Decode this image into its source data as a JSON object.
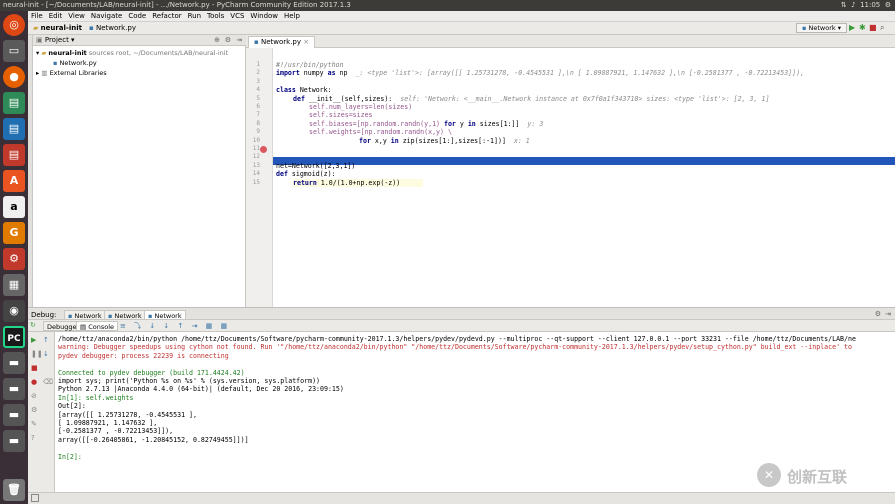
{
  "window": {
    "title": "neural-init - [~/Documents/LAB/neural-init] - .../Network.py - PyCharm Community Edition 2017.1.3",
    "clock": "11:05"
  },
  "menu": [
    "File",
    "Edit",
    "View",
    "Navigate",
    "Code",
    "Refactor",
    "Run",
    "Tools",
    "VCS",
    "Window",
    "Help"
  ],
  "nav": {
    "crumb1": "neural-init",
    "crumb2": "Network.py",
    "run_config": "Network"
  },
  "project": {
    "header": "Project",
    "root": "neural-init",
    "root_note": "sources root, ~/Documents/LAB/neural-init",
    "file": "Network.py",
    "ext": "External Libraries"
  },
  "editor": {
    "tab": "Network.py",
    "line_numbers": [
      "1",
      "2",
      "3",
      "4",
      "5",
      "6",
      "7",
      "8",
      "9",
      "10",
      "11",
      "12",
      "13",
      "14",
      "15"
    ]
  },
  "code": {
    "l1": "#!/usr/bin/python",
    "l2a": "import",
    "l2b": " numpy ",
    "l2c": "as",
    "l2d": " np",
    "l2h": "_: <type 'list'>: [array([[ 1.25731278, -0.4545531 ],\\n       [ 1.09887921,  1.147632  ],\\n       [-0.2581377 , -0.72213453]]),",
    "l4a": "class",
    "l4b": " Network:",
    "l5a": "def",
    "l5b": " __init__(self,sizes):",
    "l5h": "self: 'Network: <__main__.Network instance at 0x7f0a1f343710>  sizes: <type 'list'>: [2, 3, 1]",
    "l6": "self.num_layers=len(sizes)",
    "l7": "self.sizes=sizes",
    "l8a": "self.biases=[np.random.randn(y,1) ",
    "l8b": "for",
    "l8c": " y ",
    "l8d": "in",
    "l8e": " sizes[1:]]",
    "l8h": "y: 3",
    "l9": "self.weights=[np.random.randn(x,y) \\",
    "l10a": "for",
    "l10b": " x,y ",
    "l10c": "in",
    "l10d": " zip(sizes[1:],sizes[:-1])]",
    "l10h": "x: 1",
    "l11": "self.null=[]",
    "l13": "net=Network([2,3,1])",
    "l14a": "def",
    "l14b": " sigmoid(z):",
    "l15a": "return",
    "l15b": " 1.0/(1.0+np.exp(-z))"
  },
  "debug": {
    "label": "Debug:",
    "tabs": [
      "Network",
      "Network",
      "Network"
    ],
    "debugger_tab": "Debugger",
    "console_tab": "Console"
  },
  "console": [
    "/home/ttz/anaconda2/bin/python /home/ttz/Documents/Software/pycharm-community-2017.1.3/helpers/pydev/pydevd.py --multiproc --qt-support --client 127.0.0.1 --port 33231 --file /home/ttz/Documents/LAB/ne",
    "warning: Debugger speedups using cython not found. Run '\"/home/ttz/anaconda2/bin/python\" \"/home/ttz/Documents/Software/pycharm-community-2017.1.3/helpers/pydev/setup_cython.py\" build_ext --inplace' to",
    "pydev debugger: process 22239 is connecting",
    "",
    "Connected to pydev debugger (build 171.4424.42)",
    "import sys; print('Python %s on %s' % (sys.version, sys.platform))",
    "Python 2.7.13 |Anaconda 4.4.0 (64-bit)| (default, Dec 20 2016, 23:09:15)",
    "In[1]: self.weights",
    "Out[2]:",
    "[array([[ 1.25731278, -0.4545531 ],",
    "        [ 1.09887921,  1.147632  ],",
    "        [-0.2581377 , -0.72213453]]),",
    " array([[-0.26405861, -1.20845152,  0.82749455]])]",
    "",
    "In[2]:"
  ],
  "watermark": {
    "text": "创新互联"
  },
  "colors": {
    "highlight": "#2256b8",
    "keyword": "#000080",
    "launcher": "#3a2e37"
  }
}
